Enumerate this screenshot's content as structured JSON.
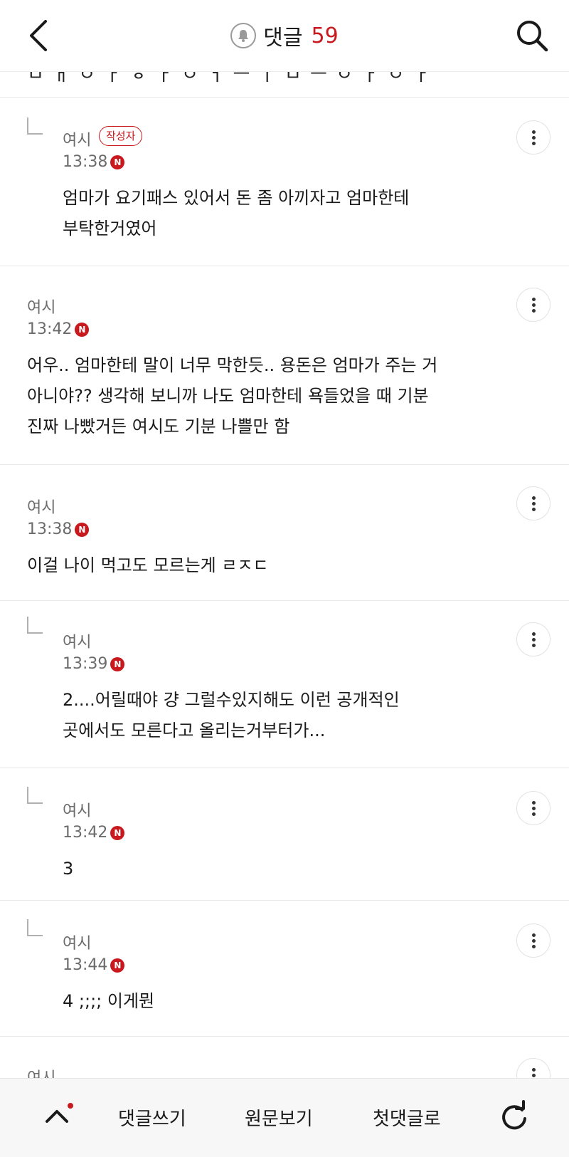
{
  "header": {
    "title": "댓글",
    "count": "59"
  },
  "top_clipped_text": "ㅁ ㅐ ㅇ ㅏ ㅎ ㅏ ㅇ ㅓ ㅡ ㅣ ㅁ ㅡ ㅇ ㅏ ㅇ ㅏ",
  "comments": [
    {
      "author": "여시",
      "badge": "작성자",
      "time": "13:38",
      "new_mark": "N",
      "text": "엄마가 요기패스 있어서 돈 좀 아끼자고 엄마한테\n부탁한거였어",
      "is_reply": true
    },
    {
      "author": "여시",
      "time": "13:42",
      "new_mark": "N",
      "text": "어우.. 엄마한테 말이 너무 막한듯.. 용돈은 엄마가 주는 거\n아니야?? 생각해 보니까 나도 엄마한테 욕들었을 때 기분\n진짜 나빴거든 여시도 기분 나쁠만 함",
      "is_reply": false
    },
    {
      "author": "여시",
      "time": "13:38",
      "new_mark": "N",
      "text": "이걸 나이 먹고도 모르는게 ㄹㅈㄷ",
      "is_reply": false
    },
    {
      "author": "여시",
      "time": "13:39",
      "new_mark": "N",
      "text": "2....어릴때야 걍 그럴수있지해도 이런 공개적인\n곳에서도 모른다고 올리는거부터가...",
      "is_reply": true
    },
    {
      "author": "여시",
      "time": "13:42",
      "new_mark": "N",
      "text": "3",
      "is_reply": true
    },
    {
      "author": "여시",
      "time": "13:44",
      "new_mark": "N",
      "text": "4 ;;;; 이게뭔",
      "is_reply": true
    },
    {
      "author": "여시",
      "is_reply": false
    }
  ],
  "bottom_bar": {
    "write_comment": "댓글쓰기",
    "view_original": "원문보기",
    "first_comment": "첫댓글로"
  },
  "colors": {
    "accent": "#c8191e",
    "meta_text": "#6b6b6b",
    "divider": "#e8e8e8"
  },
  "icons": [
    "back-arrow-icon",
    "bell-icon",
    "search-icon",
    "more-vertical-icon",
    "chevron-up-icon",
    "refresh-icon"
  ]
}
